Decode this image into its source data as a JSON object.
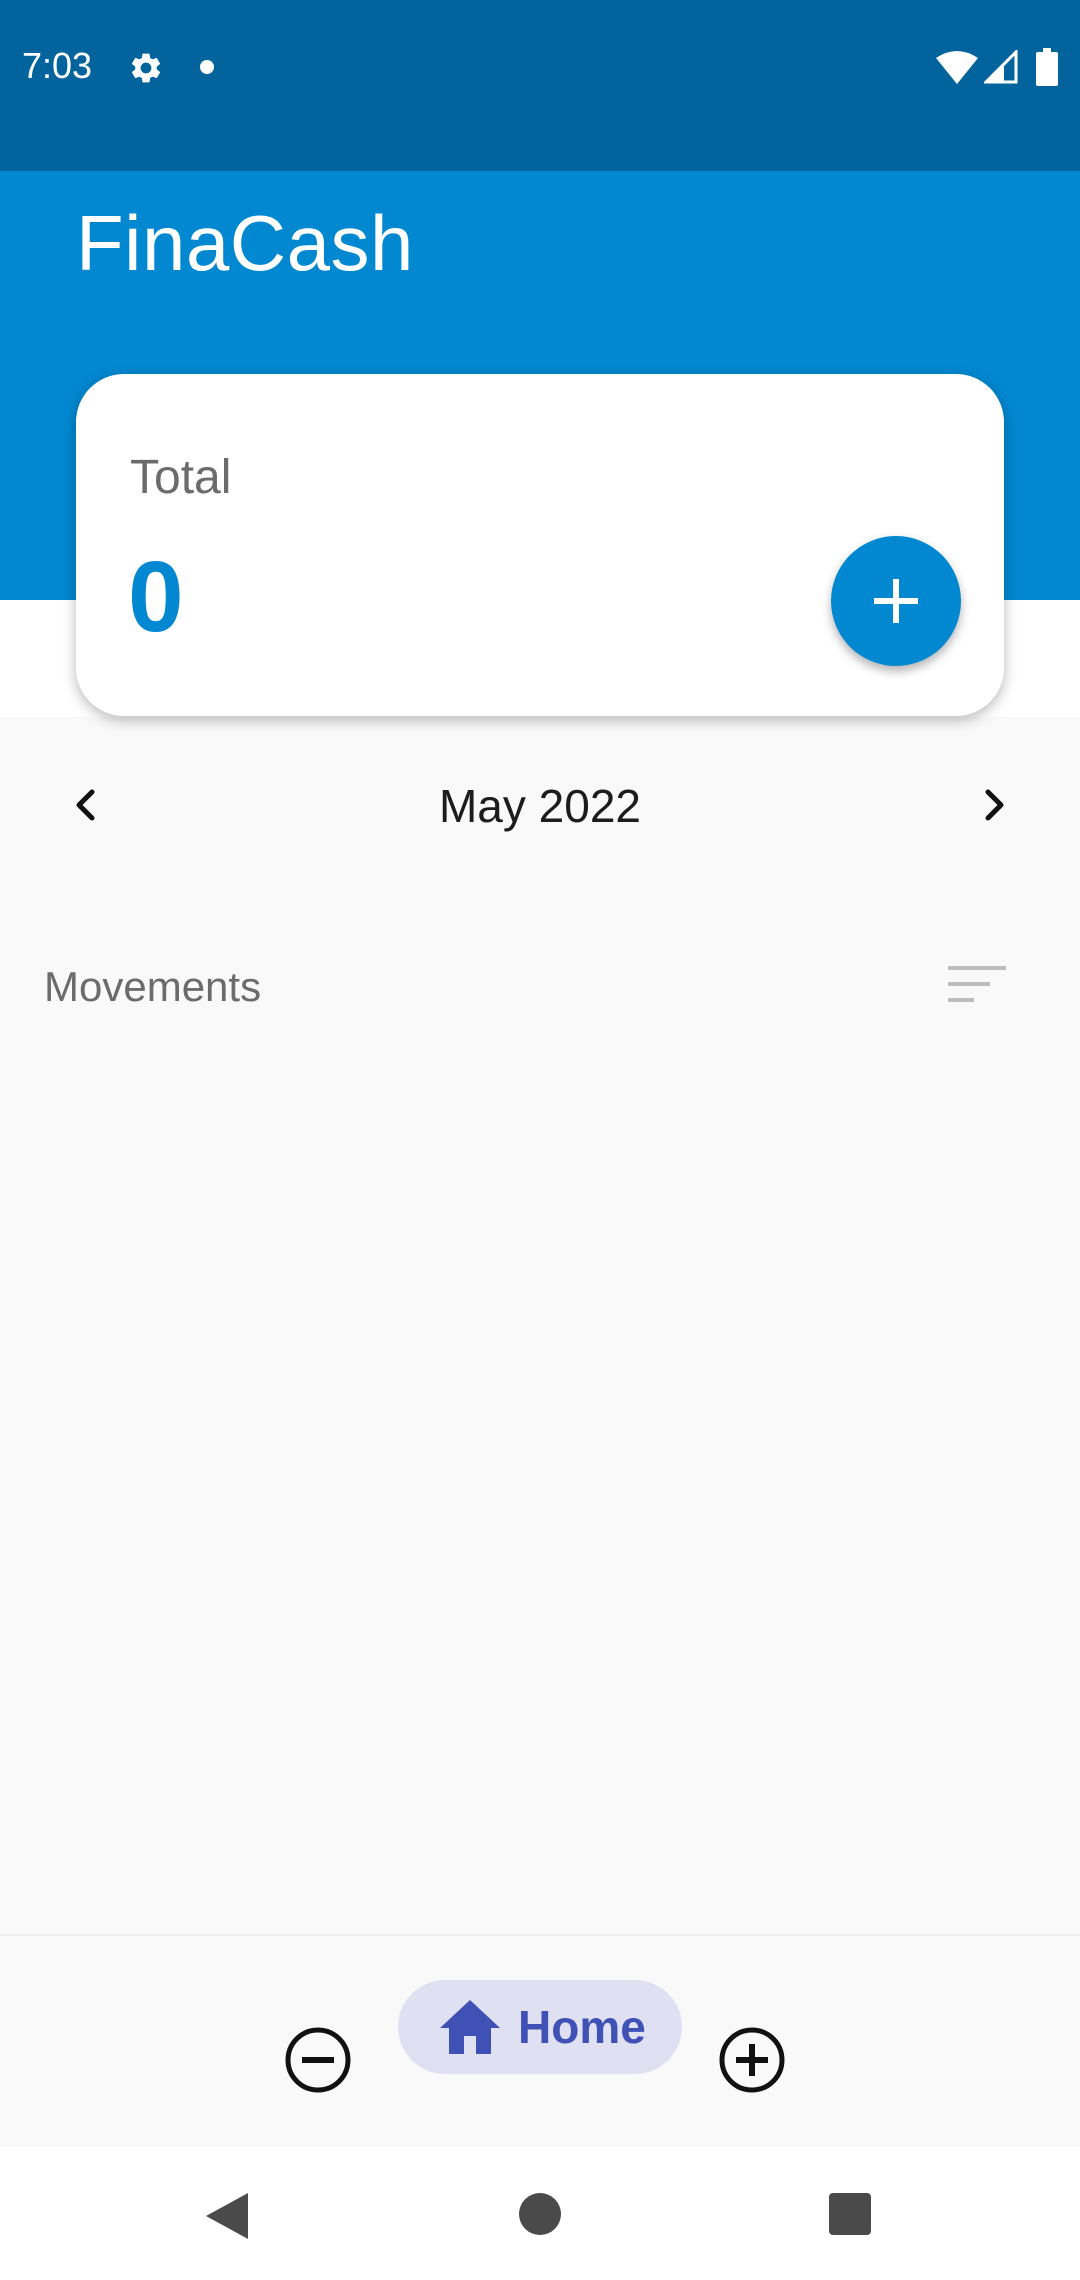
{
  "status_bar": {
    "time": "7:03",
    "icons": [
      "gear-icon",
      "notification-dot-icon",
      "wifi-icon",
      "signal-icon",
      "battery-icon"
    ]
  },
  "app": {
    "title": "FinaCash"
  },
  "total_card": {
    "label": "Total",
    "value": "0",
    "add_button_icon": "plus-icon"
  },
  "month_nav": {
    "current_month": "May 2022",
    "prev_icon": "chevron-left-icon",
    "next_icon": "chevron-right-icon"
  },
  "movements": {
    "label": "Movements",
    "sort_icon": "sort-icon"
  },
  "bottom_nav": {
    "items": [
      {
        "icon": "minus-circle-icon",
        "label": ""
      },
      {
        "icon": "home-icon",
        "label": "Home",
        "selected": true
      },
      {
        "icon": "plus-circle-icon",
        "label": ""
      }
    ]
  },
  "system_nav": {
    "icons": [
      "back-icon",
      "home-circle-icon",
      "recents-icon"
    ]
  },
  "colors": {
    "status_bar": "#03649d",
    "primary": "#0288d1",
    "nav_selected_bg": "#dfe1f2",
    "nav_selected_text": "#3f51b5",
    "background": "#f9f9f9"
  }
}
